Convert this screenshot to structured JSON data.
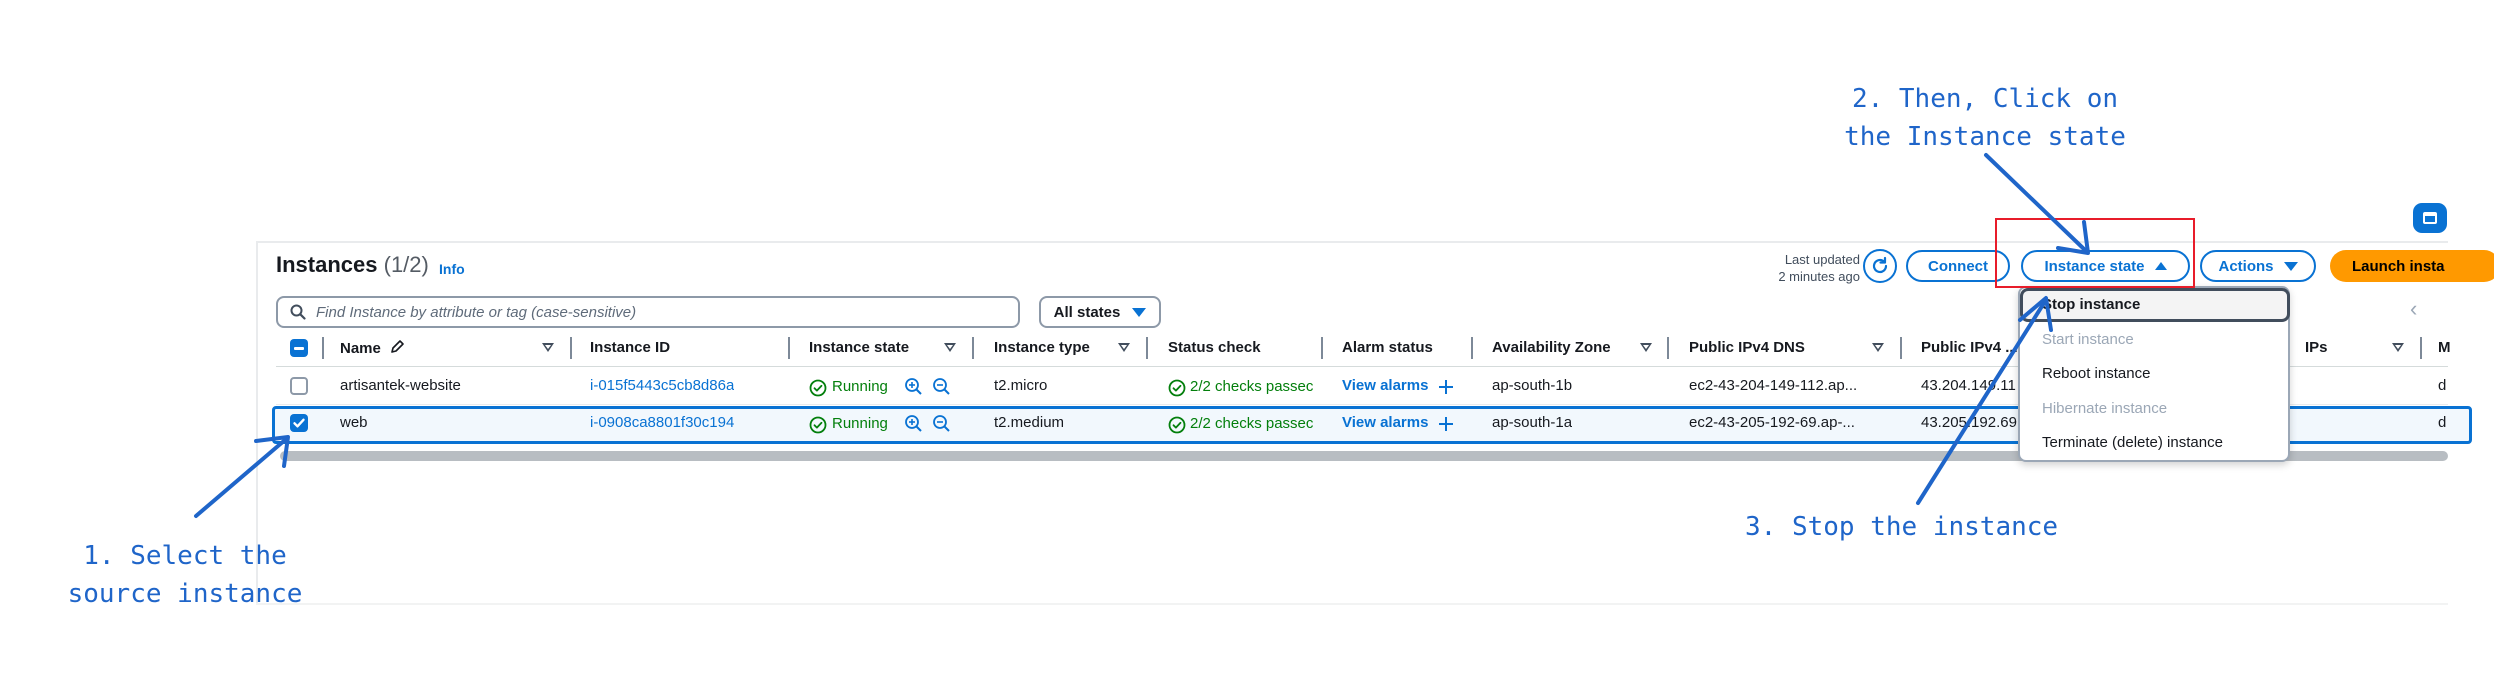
{
  "panel": {
    "title": "Instances",
    "count": "(1/2)",
    "info_link": "Info",
    "last_updated_line1": "Last updated",
    "last_updated_line2": "2 minutes ago"
  },
  "toolbar": {
    "refresh_icon": "refresh-icon",
    "connect_label": "Connect",
    "instance_state_label": "Instance state",
    "actions_label": "Actions",
    "launch_label": "Launch insta"
  },
  "search": {
    "placeholder": "Find Instance by attribute or tag (case-sensitive)",
    "value": ""
  },
  "filter": {
    "states_label": "All states"
  },
  "columns": {
    "name": "Name",
    "instance_id": "Instance ID",
    "instance_state": "Instance state",
    "instance_type": "Instance type",
    "status_check": "Status check",
    "alarm_status": "Alarm status",
    "availability_zone": "Availability Zone",
    "public_dns": "Public IPv4 DNS",
    "public_ip": "Public IPv4 ...",
    "ips": "IPs",
    "more": "M"
  },
  "rows": [
    {
      "selected": false,
      "name": "artisantek-website",
      "instance_id": "i-015f5443c5cb8d86a",
      "state": "Running",
      "type": "t2.micro",
      "status_check": "2/2 checks passec",
      "alarm": "View alarms",
      "az": "ap-south-1b",
      "dns": "ec2-43-204-149-112.ap...",
      "ip": "43.204.149.11",
      "last": "d"
    },
    {
      "selected": true,
      "name": "web",
      "instance_id": "i-0908ca8801f30c194",
      "state": "Running",
      "type": "t2.medium",
      "status_check": "2/2 checks passec",
      "alarm": "View alarms",
      "az": "ap-south-1a",
      "dns": "ec2-43-205-192-69.ap-...",
      "ip": "43.205.192.69",
      "last": "d"
    }
  ],
  "menu": {
    "items": [
      {
        "label": "Stop instance",
        "enabled": true,
        "highlighted": true
      },
      {
        "label": "Start instance",
        "enabled": false
      },
      {
        "label": "Reboot instance",
        "enabled": true
      },
      {
        "label": "Hibernate instance",
        "enabled": false
      },
      {
        "label": "Terminate (delete) instance",
        "enabled": true
      }
    ]
  },
  "annotations": {
    "step1_line1": "1. Select the",
    "step1_line2": "source instance",
    "step2_line1": "2. Then, Click on",
    "step2_line2": "the Instance state",
    "step3": "3. Stop the instance"
  },
  "colors": {
    "accent": "#0972d3",
    "primary_button": "#ff9900",
    "success": "#037f0c",
    "annotation": "#1f65c9",
    "highlight_box": "#e81c2a"
  }
}
